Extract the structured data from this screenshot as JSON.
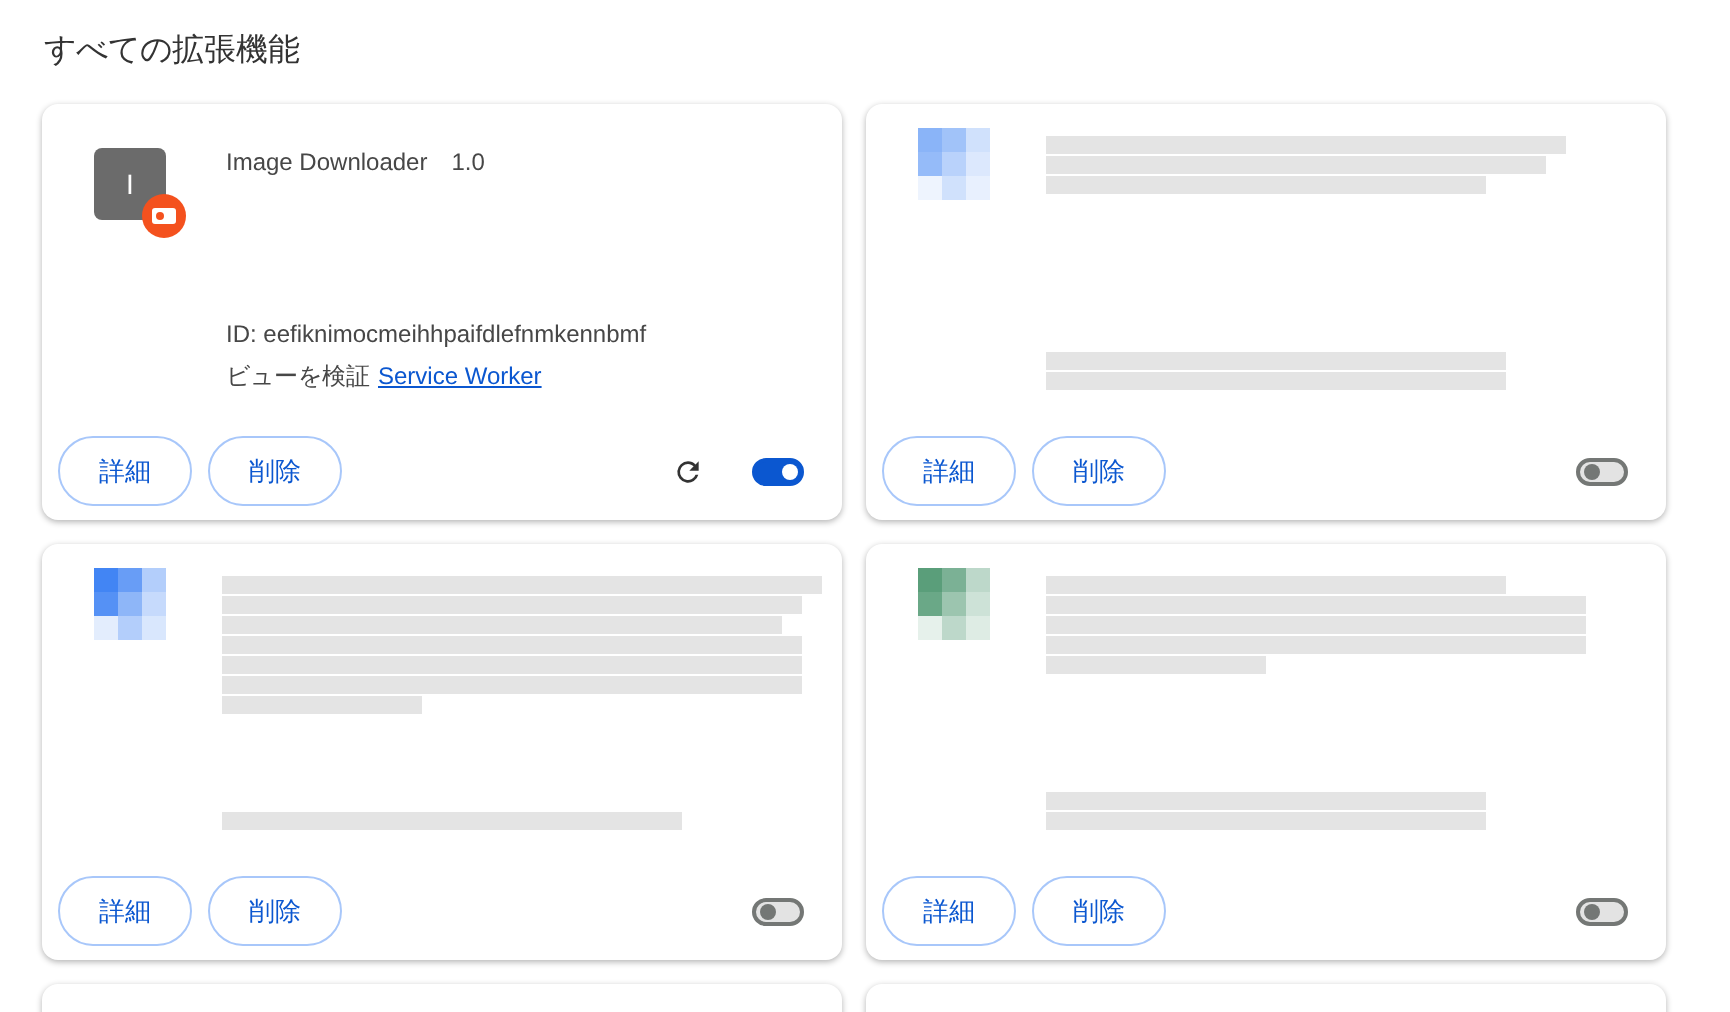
{
  "heading": "すべての拡張機能",
  "extensions": [
    {
      "kind": "detailed",
      "icon_letter": "I",
      "name": "Image Downloader",
      "version": "1.0",
      "id_text": "ID: eefiknimocmeihhpaifdlefnmkennbmf",
      "inspect_label": "ビューを検証",
      "inspect_link": "Service Worker",
      "details_button": "詳細",
      "remove_button": "削除",
      "reload_button": true,
      "enabled": true
    },
    {
      "kind": "redacted",
      "color": "#8ab4f8",
      "details_button": "詳細",
      "remove_button": "削除",
      "reload_button": false,
      "enabled": false
    },
    {
      "kind": "redacted",
      "color": "#4285f4",
      "details_button": "詳細",
      "remove_button": "削除",
      "reload_button": false,
      "enabled": false
    },
    {
      "kind": "redacted",
      "color": "#5a9e7a",
      "details_button": "詳細",
      "remove_button": "削除",
      "reload_button": false,
      "enabled": false
    },
    {
      "kind": "cut_off"
    },
    {
      "kind": "cut_off"
    }
  ]
}
